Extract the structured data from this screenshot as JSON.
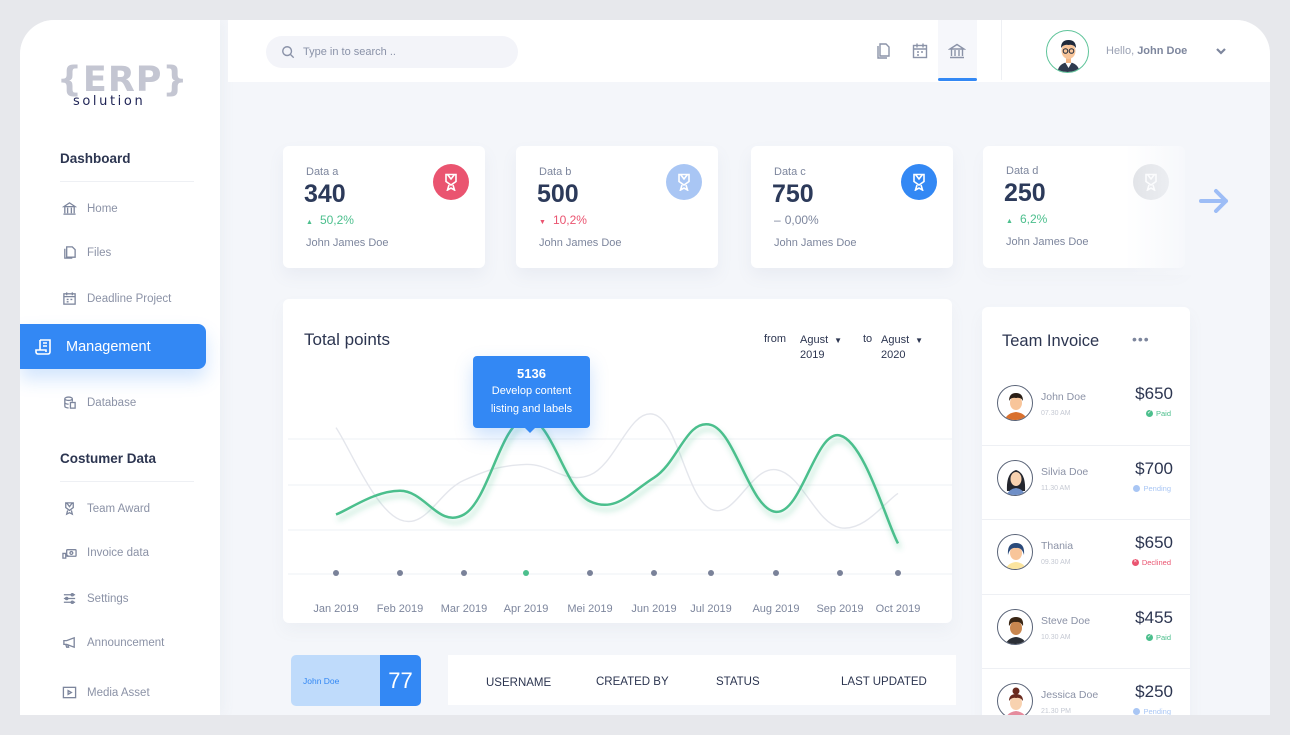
{
  "sidebar": {
    "logo": {
      "main": "{ERP}",
      "sub": "solution"
    },
    "sections": [
      {
        "title": "Dashboard",
        "items": [
          {
            "label": "Home",
            "icon": "bank-icon"
          },
          {
            "label": "Files",
            "icon": "files-icon"
          },
          {
            "label": "Deadline Project",
            "icon": "calendar-icon"
          },
          {
            "label": "Management",
            "icon": "scroll-icon",
            "active": true
          },
          {
            "label": "Database",
            "icon": "database-icon"
          }
        ]
      },
      {
        "title": "Costumer Data",
        "items": [
          {
            "label": "Team Award",
            "icon": "award-icon"
          },
          {
            "label": "Invoice data",
            "icon": "money-icon"
          },
          {
            "label": "Settings",
            "icon": "sliders-icon"
          },
          {
            "label": "Announcement",
            "icon": "megaphone-icon"
          },
          {
            "label": "Media Asset",
            "icon": "media-icon"
          }
        ]
      }
    ]
  },
  "topbar": {
    "search_placeholder": "Type in to search ..",
    "icons": [
      "files-icon",
      "calendar-icon",
      "bank-icon"
    ],
    "active_icon": "bank-icon",
    "greeting": "Hello,",
    "user_name": "John Doe"
  },
  "stats": [
    {
      "label": "Data a",
      "value": "340",
      "change": "50,2%",
      "trend": "up",
      "person": "John James Doe",
      "icon_color": "#ea5470"
    },
    {
      "label": "Data b",
      "value": "500",
      "change": "10,2%",
      "trend": "down",
      "person": "John James Doe",
      "icon_color": "#a9c6f4"
    },
    {
      "label": "Data c",
      "value": "750",
      "change": "0,00%",
      "trend": "flat",
      "person": "John James Doe",
      "icon_color": "#3388f4"
    },
    {
      "label": "Data d",
      "value": "250",
      "change": "6,2%",
      "trend": "up",
      "person": "John James Doe",
      "icon_color": "#c8cbd3"
    }
  ],
  "colors": {
    "accent": "#3388f4",
    "green": "#4cbf8d",
    "red": "#ea5470",
    "pending": "#a9c6f4"
  },
  "chart": {
    "title": "Total points",
    "from_label": "from",
    "from_month": "Agust",
    "from_year": "2019",
    "to_label": "to",
    "to_month": "Agust",
    "to_year": "2020",
    "tooltip_value": "5136",
    "tooltip_line1": "Develop content",
    "tooltip_line2": "listing and labels"
  },
  "chart_data": {
    "type": "line",
    "title": "Total points",
    "categories": [
      "Jan 2019",
      "Feb 2019",
      "Mar 2019",
      "Apr 2019",
      "Mei 2019",
      "Jun 2019",
      "Jul 2019",
      "Aug 2019",
      "Sep 2019",
      "Oct 2019"
    ],
    "highlight_index": 3,
    "series": [
      {
        "name": "primary",
        "color": "#4cbf8d",
        "values": [
          1500,
          2400,
          1500,
          5136,
          2000,
          2900,
          4900,
          1600,
          4500,
          400
        ]
      },
      {
        "name": "secondary",
        "color": "#e4e6ec",
        "values": [
          4800,
          1300,
          2800,
          3400,
          3000,
          5300,
          1700,
          3200,
          1000,
          2300
        ]
      }
    ],
    "ylim": [
      0,
      6000
    ],
    "grid": true
  },
  "invoice": {
    "title": "Team Invoice",
    "more": "•••",
    "rows": [
      {
        "name": "John Doe",
        "time": "07.30 AM",
        "amount": "$650",
        "status": "Paid"
      },
      {
        "name": "Silvia Doe",
        "time": "11.30 AM",
        "amount": "$700",
        "status": "Pending"
      },
      {
        "name": "Thania",
        "time": "09.30 AM",
        "amount": "$650",
        "status": "Declined"
      },
      {
        "name": "Steve Doe",
        "time": "10.30 AM",
        "amount": "$455",
        "status": "Paid"
      },
      {
        "name": "Jessica Doe",
        "time": "21.30 PM",
        "amount": "$250",
        "status": "Pending"
      }
    ]
  },
  "bottom": {
    "chip_name": "John Doe",
    "chip_count": "77",
    "columns": [
      "USERNAME",
      "CREATED BY",
      "STATUS",
      "LAST UPDATED"
    ]
  }
}
